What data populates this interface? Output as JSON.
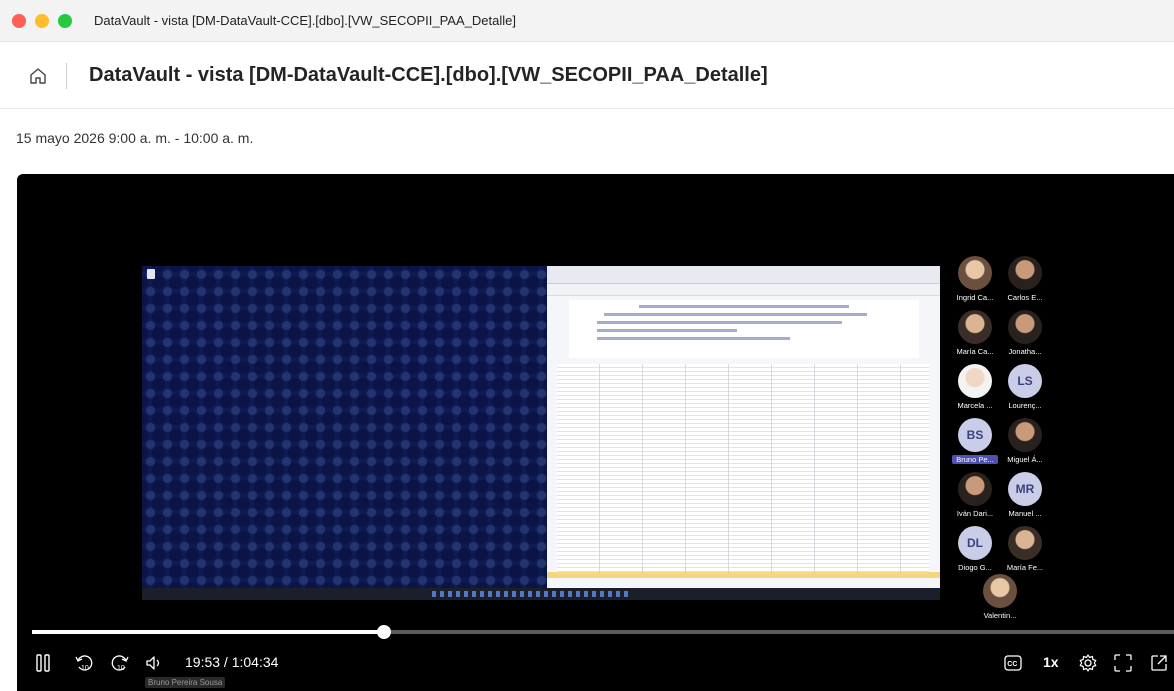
{
  "window": {
    "title": "DataVault - vista [DM-DataVault-CCE].[dbo].[VW_SECOPII_PAA_Detalle]"
  },
  "header": {
    "title": "DataVault - vista [DM-DataVault-CCE].[dbo].[VW_SECOPII_PAA_Detalle]",
    "home_icon": "home-icon"
  },
  "meeting": {
    "datetime": "15 mayo 2026 9:00 a. m. - 10:00 a. m."
  },
  "participants": [
    {
      "name": "Ingrid Ca...",
      "avatar": "photo"
    },
    {
      "name": "Carlos E...",
      "avatar": "photo"
    },
    {
      "name": "María Ca...",
      "avatar": "photo"
    },
    {
      "name": "Jonatha...",
      "avatar": "photo"
    },
    {
      "name": "Marcela ...",
      "avatar": "photo"
    },
    {
      "name": "Lourenç...",
      "initials": "LS"
    },
    {
      "name": "Bruno Pe...",
      "initials": "BS",
      "highlighted": true
    },
    {
      "name": "Miguel Á...",
      "avatar": "photo"
    },
    {
      "name": "Iván Dari...",
      "avatar": "photo"
    },
    {
      "name": "Manuel ...",
      "initials": "MR"
    },
    {
      "name": "Diogo G...",
      "initials": "DL"
    },
    {
      "name": "María Fe...",
      "avatar": "photo"
    },
    {
      "name": "Valentin...",
      "avatar": "photo"
    }
  ],
  "player": {
    "current_time": "19:53",
    "duration": "1:04:34",
    "time_display": "19:53 / 1:04:34",
    "progress_fraction": 0.308,
    "tooltip": "Bruno Pereira Sousa",
    "speed": "1x",
    "icons": {
      "pause": "pause-icon",
      "rewind": "rewind-10-icon",
      "forward": "forward-10-icon",
      "volume": "volume-icon",
      "captions": "captions-icon",
      "settings": "settings-icon",
      "fullscreen": "fullscreen-icon",
      "popout": "popout-icon"
    }
  }
}
